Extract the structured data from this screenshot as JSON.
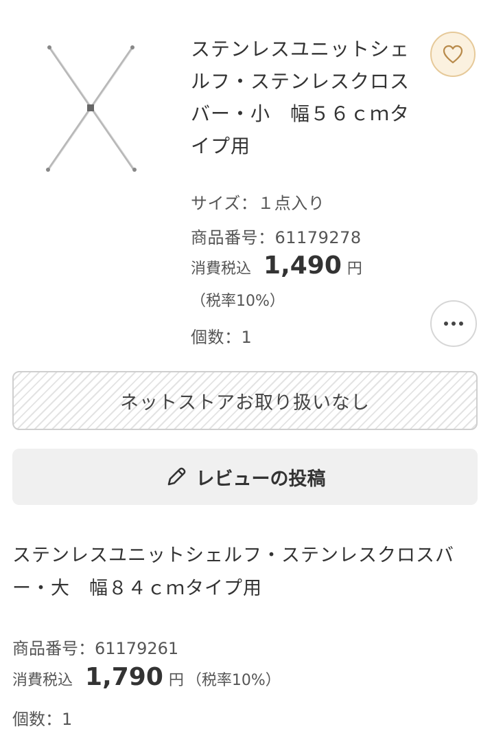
{
  "product1": {
    "title": "ステンレスユニットシェルフ・ステンレスクロスバー・小　幅５６ｃｍタイプ用",
    "size": "サイズ：１点入り",
    "item_number": "商品番号：61179278",
    "price_label": "消費税込",
    "price": "1,490",
    "price_unit": "円",
    "tax_rate": "（税率10%）",
    "quantity": "個数：1"
  },
  "actions": {
    "unavailable_label": "ネットストアお取り扱いなし",
    "review_label": "レビューの投稿"
  },
  "product2": {
    "title": "ステンレスユニットシェルフ・ステンレスクロスバー・大　幅８４ｃｍタイプ用",
    "item_number": "商品番号：61179261",
    "price_label": "消費税込",
    "price": "1,790",
    "price_unit": "円",
    "tax_rate": "（税率10%）",
    "quantity": "個数：1"
  },
  "icons": {
    "favorite": "heart-icon",
    "more": "more-dots-icon",
    "review": "pencil-icon"
  },
  "colors": {
    "favorite_bg": "#fbf1df",
    "favorite_border": "#e6c999",
    "button_bg": "#f0f0f0"
  }
}
